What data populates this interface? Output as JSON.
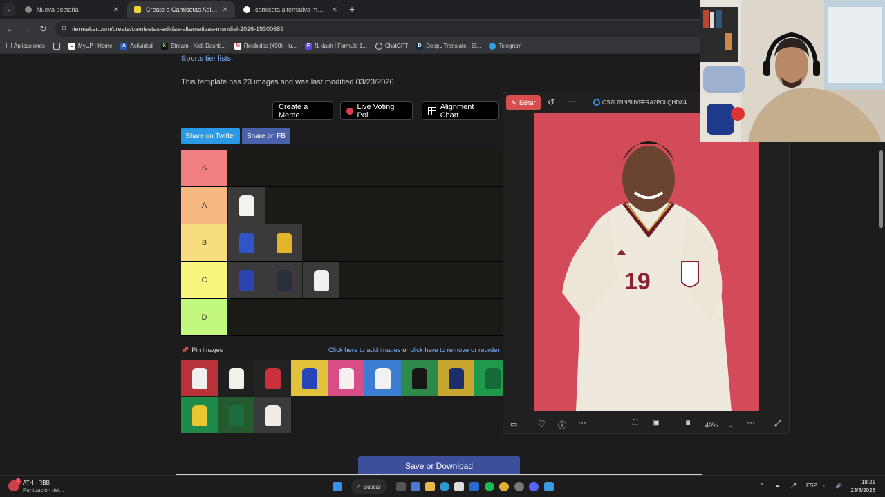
{
  "browser": {
    "tabs": [
      {
        "title": "Nueva pestaña",
        "active": false
      },
      {
        "title": "Create a Camisetas Adidas alter",
        "active": true
      },
      {
        "title": "camiseta alternativa mundial 20",
        "active": false
      }
    ],
    "url": "tiermaker.com/create/camisetas-adidas-alternativas-mundial-2026-19300689",
    "bookmarks": [
      {
        "label": "Aplicaciones",
        "icon": "apps-icon"
      },
      {
        "label": "",
        "icon": "grid-icon"
      },
      {
        "label": "MyUP | Home",
        "icon": "myup-icon"
      },
      {
        "label": "Actividad",
        "icon": "strava-icon"
      },
      {
        "label": "Stream - Kick Dashb...",
        "icon": "kick-icon"
      },
      {
        "label": "Recibidos (490) - lu...",
        "icon": "gmail-icon"
      },
      {
        "label": "f1-dash | Formula 1...",
        "icon": "f1-icon"
      },
      {
        "label": "ChatGPT",
        "icon": "chatgpt-icon"
      },
      {
        "label": "DeepL Translate - El...",
        "icon": "deepl-icon"
      },
      {
        "label": "Telegram",
        "icon": "telegram-icon"
      }
    ]
  },
  "page": {
    "link_text": "Sports tier lists.",
    "info_text": "This template has 23 images and was last modified 03/23/2026.",
    "buttons": {
      "meme": "Create a Meme",
      "poll": "Live Voting Poll",
      "alignment": "Alignment Chart",
      "twitter": "Share on Twitter",
      "fb": "Share on FB",
      "save": "Save or Download"
    },
    "tiers": [
      {
        "label": "S",
        "color": "#f27f7f",
        "items": []
      },
      {
        "label": "A",
        "color": "#f7b87f",
        "items": [
          "#f2f2ee"
        ]
      },
      {
        "label": "B",
        "color": "#f7dd80",
        "items": [
          "#2f55c8",
          "#e2b52a"
        ]
      },
      {
        "label": "C",
        "color": "#f9f57e",
        "items": [
          "#2a44b0",
          "#2a2f3f",
          "#f0f0f0"
        ]
      },
      {
        "label": "D",
        "color": "#c3f87f",
        "items": []
      }
    ],
    "pin_label": "Pin Images",
    "add_link": "Click here to add images",
    "or_text": "or",
    "remove_link": "click here to remove or reorder",
    "pool": [
      {
        "bg": "#b8323a",
        "shirt": "#efefef"
      },
      {
        "bg": "#1f1f1f",
        "shirt": "#f2f0ea"
      },
      {
        "bg": "#222222",
        "shirt": "#c9323d"
      },
      {
        "bg": "#e2c23a",
        "shirt": "#2546b8"
      },
      {
        "bg": "#d84d86",
        "shirt": "#f4f0f0"
      },
      {
        "bg": "#3c7ed4",
        "shirt": "#f2f2f2"
      },
      {
        "bg": "#2e8a4a",
        "shirt": "#161616"
      },
      {
        "bg": "#c9a532",
        "shirt": "#1d2f6a"
      },
      {
        "bg": "#1f9a4b",
        "shirt": "#156a3a"
      },
      {
        "bg": "#1f8a4a",
        "shirt": "#e7c62f"
      },
      {
        "bg": "#235a2e",
        "shirt": "#1b6e3c"
      },
      {
        "bg": "#3a3a3a",
        "shirt": "#f2ece6"
      }
    ]
  },
  "viewer": {
    "edit_label": "Editar",
    "filename": "OS7L7NNSUVFFRA2POLQHDX4...",
    "zoom": "49%",
    "jersey_number": "19"
  },
  "taskbar": {
    "weather_l1": "ATH - RBB",
    "weather_l2": "Puntuación del...",
    "badge": "3",
    "search": "Buscar",
    "lang": "ESP",
    "time": "18:21",
    "date": "23/3/2026"
  }
}
